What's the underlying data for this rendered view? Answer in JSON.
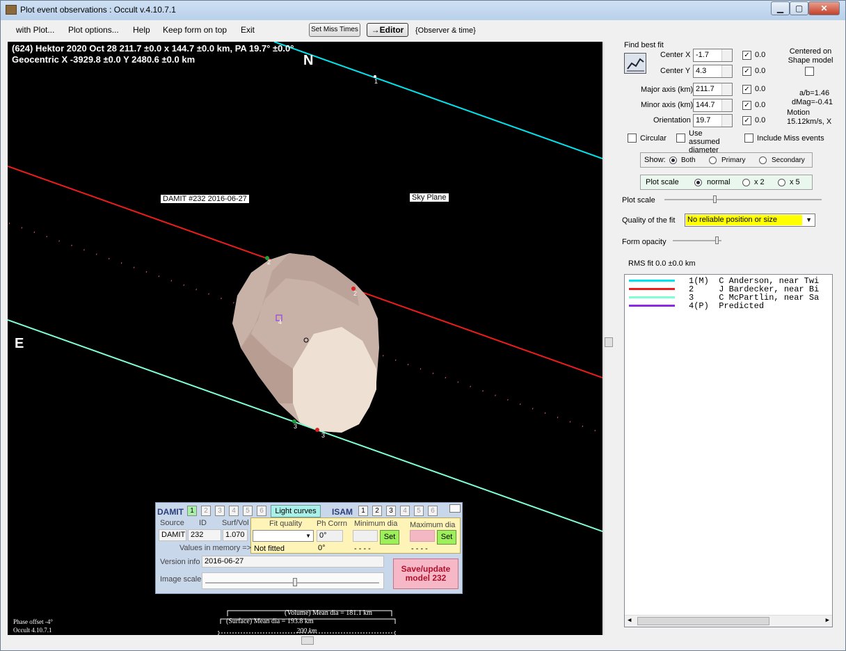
{
  "window": {
    "title": "Plot event observations : Occult v.4.10.7.1",
    "min": "▁",
    "max": "▢",
    "close": "✕"
  },
  "menu": {
    "with_plot": "with Plot...",
    "plot_options": "Plot options...",
    "help": "Help",
    "keep_on_top": "Keep form on top",
    "exit": "Exit"
  },
  "toolbar": {
    "set_miss_times": "Set Miss Times",
    "editor": "→Editor",
    "observer_time": "{Observer & time}"
  },
  "plot": {
    "header_line1": "(624) Hektor  2020 Oct 28   211.7 ±0.0 x 144.7 ±0.0 km, PA 19.7° ±0.0°",
    "header_line2": "Geocentric  X  -3929.8 ±0.0  Y 2480.6 ±0.0 km",
    "north": "N",
    "east": "E",
    "damit_label": "DAMIT #232 2016-06-27",
    "sky_plane": "Sky Plane",
    "chord_labels": [
      "1",
      "2",
      "2",
      "4",
      "3",
      "3"
    ],
    "phase_offset": "Phase offset -4°",
    "version": "Occult 4.10.7.1",
    "volume_dia": "(Volume) Mean dia = 181.1 km",
    "surface_dia": "(Surface) Mean dia = 193.8 km",
    "scale": "200 km"
  },
  "damit_panel": {
    "damit": "DAMIT",
    "isam": "ISAM",
    "damit_buttons": [
      "1",
      "2",
      "3",
      "4",
      "5",
      "6"
    ],
    "isam_buttons": [
      "1",
      "2",
      "3",
      "4",
      "5",
      "6"
    ],
    "light_curves": "Light curves",
    "source_label": "Source",
    "id_label": "ID",
    "surfvol_label": "Surf/Vol",
    "source": "DAMIT",
    "id": "232",
    "surfvol": "1.070",
    "fit_quality_label": "Fit quality",
    "ph_corrn_label": "Ph Corrn",
    "min_dia_label": "Minimum dia",
    "max_dia_label": "Maximum dia",
    "ph_corrn": "0°",
    "set": "Set",
    "values_in_memory": "Values in memory =>",
    "not_fitted": "Not fitted",
    "ph_mem": "0°",
    "min_mem": "- - - -",
    "max_mem": "- - - -",
    "version_info_label": "Version info",
    "version_info": "2016-06-27",
    "image_scale_label": "Image scale",
    "save_update": "Save/update model 232"
  },
  "fit": {
    "find_best_fit": "Find best fit",
    "center_x_label": "Center X",
    "center_x": "-1.7",
    "center_x_chk": "0.0",
    "center_y_label": "Center Y",
    "center_y": "4.3",
    "center_y_chk": "0.0",
    "major_label": "Major axis (km)",
    "major": "211.7",
    "major_chk": "0.0",
    "minor_label": "Minor axis (km)",
    "minor": "144.7",
    "minor_chk": "0.0",
    "orient_label": "Orientation",
    "orient": "19.7",
    "orient_chk": "0.0",
    "centered_on": "Centered on Shape model",
    "ab": "a/b=1.46",
    "dmag": "dMag=-0.41",
    "motion": "Motion",
    "motion_val": "15.12km/s, X",
    "circular": "Circular",
    "use_assumed": "Use assumed diameter",
    "include_miss": "Include Miss events",
    "show": "Show:",
    "both": "Both",
    "primary": "Primary",
    "secondary": "Secondary",
    "plot_scale": "Plot scale",
    "normal": "normal",
    "x2": "x 2",
    "x5": "x 5",
    "plot_scale_slider": "Plot scale",
    "quality_label": "Quality of the fit",
    "quality": "No reliable position or size",
    "form_opacity": "Form opacity",
    "rms": "RMS fit 0.0 ±0.0 km"
  },
  "legend": [
    {
      "color": "#00e5ee",
      "text": "1(M)  C Anderson, near Twi"
    },
    {
      "color": "#ee1c1c",
      "text": "2     J Bardecker, near Bi"
    },
    {
      "color": "#7fffd4",
      "text": "3     C McPartlin, near Sa"
    },
    {
      "color": "#8a2be2",
      "text": "4(P)  Predicted"
    }
  ]
}
